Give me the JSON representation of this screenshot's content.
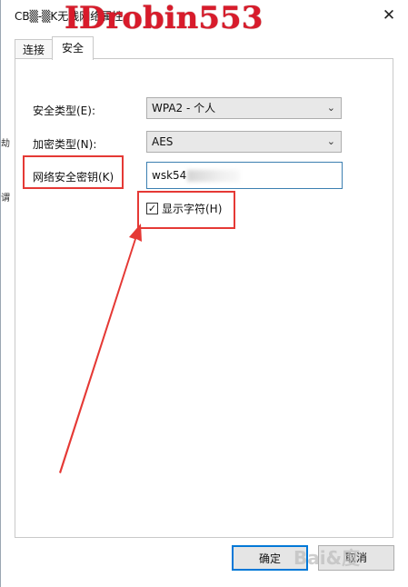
{
  "window": {
    "title": "CB▒-▒K无线网络属性",
    "watermark": "IDrobin553",
    "close_glyph": "✕"
  },
  "tabs": [
    {
      "label": "连接",
      "active": false
    },
    {
      "label": "安全",
      "active": true
    }
  ],
  "security": {
    "type_label": "安全类型(E):",
    "type_value": "WPA2 - 个人",
    "encryption_label": "加密类型(N):",
    "encryption_value": "AES",
    "key_label": "网络安全密钥(K)",
    "key_value": "wsk54",
    "show_chars_label": "显示字符(H)",
    "show_chars_checked": true
  },
  "buttons": {
    "ok_label": "确定",
    "cancel_label": "取消"
  },
  "side_fragments": [
    "劫",
    "谓"
  ],
  "corner_watermark": "Bai&度",
  "icons": {
    "dropdown": "chevron-down-icon",
    "check": "checkmark-icon",
    "close": "close-icon"
  },
  "colors": {
    "highlight": "#e53935",
    "focus_border": "#3c7fb1",
    "default_button_border": "#0078d7",
    "watermark": "#d81b2b"
  }
}
